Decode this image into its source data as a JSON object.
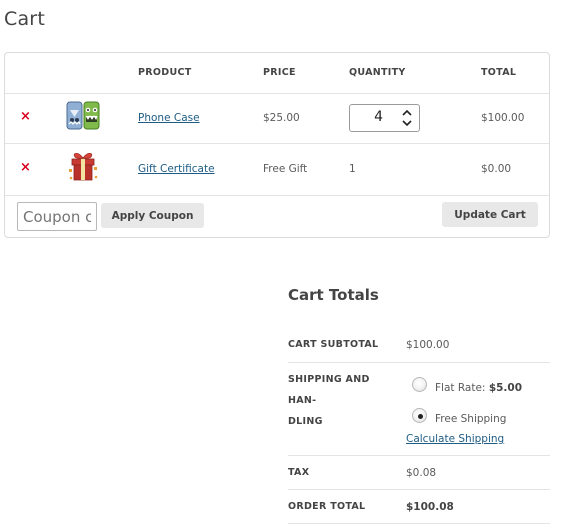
{
  "page": {
    "title": "Cart"
  },
  "cart": {
    "columns": [
      "PRODUCT",
      "PRICE",
      "QUANTITY",
      "TOTAL"
    ],
    "items": [
      {
        "remove": "×",
        "name": "Phone Case",
        "price": "$25.00",
        "quantity": "4",
        "total": "$100.00",
        "thumbnail": "phone-case-icon",
        "quantity_editable": true
      },
      {
        "remove": "×",
        "name": "Gift Certificate",
        "price": "Free Gift",
        "quantity": "1",
        "total": "$0.00",
        "thumbnail": "gift-icon",
        "quantity_editable": false
      }
    ],
    "coupon": {
      "placeholder": "Coupon code",
      "value": "",
      "apply_label": "Apply Coupon"
    },
    "update_label": "Update Cart"
  },
  "totals": {
    "title": "Cart Totals",
    "subtotal": {
      "label": "CART SUBTOTAL",
      "value": "$100.00"
    },
    "shipping": {
      "label": "SHIPPING AND HAN-\nDLING",
      "options": [
        {
          "label": "Flat Rate: ",
          "price": "$5.00",
          "selected": false
        },
        {
          "label": "Free Shipping",
          "price": "",
          "selected": true
        }
      ],
      "calculate_label": "Calculate Shipping"
    },
    "tax": {
      "label": "TAX",
      "value": "$0.08"
    },
    "order_total": {
      "label": "ORDER TOTAL",
      "value": "$100.08"
    }
  },
  "colors": {
    "remove": "#d9001e",
    "link": "#1e5c85",
    "button_bg": "#e8e8e8"
  }
}
